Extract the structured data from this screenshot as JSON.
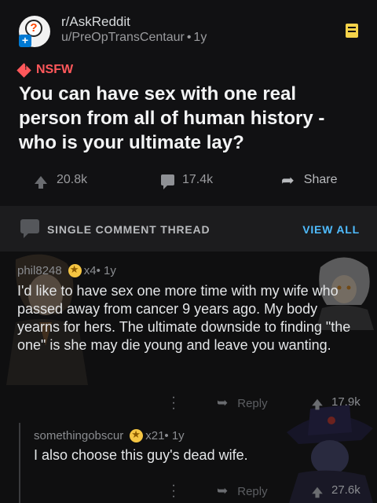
{
  "post": {
    "subreddit": "r/AskReddit",
    "author": "u/PreOpTransCentaur",
    "age": "1y",
    "nsfw_label": "NSFW",
    "title": "You can have sex with one real person from all of human history - who is your ultimate lay?",
    "upvotes": "20.8k",
    "comments": "17.4k",
    "share_label": "Share"
  },
  "thread": {
    "label": "SINGLE COMMENT THREAD",
    "view_all": "VIEW ALL"
  },
  "comments": [
    {
      "author": "phil8248",
      "award_count": "x4",
      "age": "1y",
      "body": "I'd like to have sex one more time with my wife who passed away from cancer 9 years ago. My body yearns for hers. The ultimate downside to finding \"the one\" is she may die young and leave you wanting.",
      "reply_label": "Reply",
      "score": "17.9k"
    },
    {
      "author": "somethingobscur",
      "award_count": "x21",
      "age": "1y",
      "body": "I also choose this guy's dead wife.",
      "reply_label": "Reply",
      "score": "27.6k"
    }
  ],
  "icons": [
    "subreddit-avatar-icon",
    "bookmark-icon",
    "nsfw-icon",
    "upvote-icon",
    "comment-icon",
    "share-icon",
    "thread-icon",
    "award-icon",
    "reply-icon",
    "more-icon"
  ],
  "colors": {
    "nsfw": "#ff585b",
    "link": "#4fbcff",
    "bookmark": "#f5d34a",
    "award": "#f5c542"
  }
}
